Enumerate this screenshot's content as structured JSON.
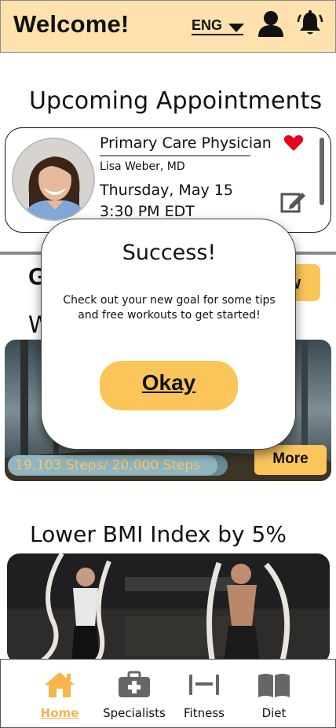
{
  "header": {
    "title": "Welcome!",
    "language": "ENG",
    "icons": [
      "chevron-down-icon",
      "user-icon",
      "bell-icon"
    ]
  },
  "appointments": {
    "title": "Upcoming Appointments",
    "card": {
      "type": "Primary Care Physician",
      "doctor": "Lisa Weber, MD",
      "date": "Thursday, May 15",
      "time": "3:30 PM EDT"
    }
  },
  "goals": {
    "title_peek": "G",
    "subtitle_peek": "W",
    "new_button_peek": "w",
    "steps_progress_text": "19,103 Steps/ 20,000 Steps",
    "steps_progress": 0.955,
    "more_label": "More",
    "bmi_title": "Lower BMI Index by 5%"
  },
  "modal": {
    "title": "Success!",
    "message": "Check out your new goal for some tips and free workouts to get started!",
    "button": "Okay"
  },
  "nav": {
    "items": [
      {
        "label": "Home",
        "icon": "home-icon",
        "active": true
      },
      {
        "label": "Specialists",
        "icon": "medical-kit-icon",
        "active": false
      },
      {
        "label": "Fitness",
        "icon": "dumbbell-icon",
        "active": false
      },
      {
        "label": "Diet",
        "icon": "book-icon",
        "active": false
      }
    ]
  },
  "colors": {
    "header_bg": "#fde2ad",
    "accent": "#fbc55a",
    "active_nav": "#f6b64a",
    "heart": "#e8001c"
  }
}
